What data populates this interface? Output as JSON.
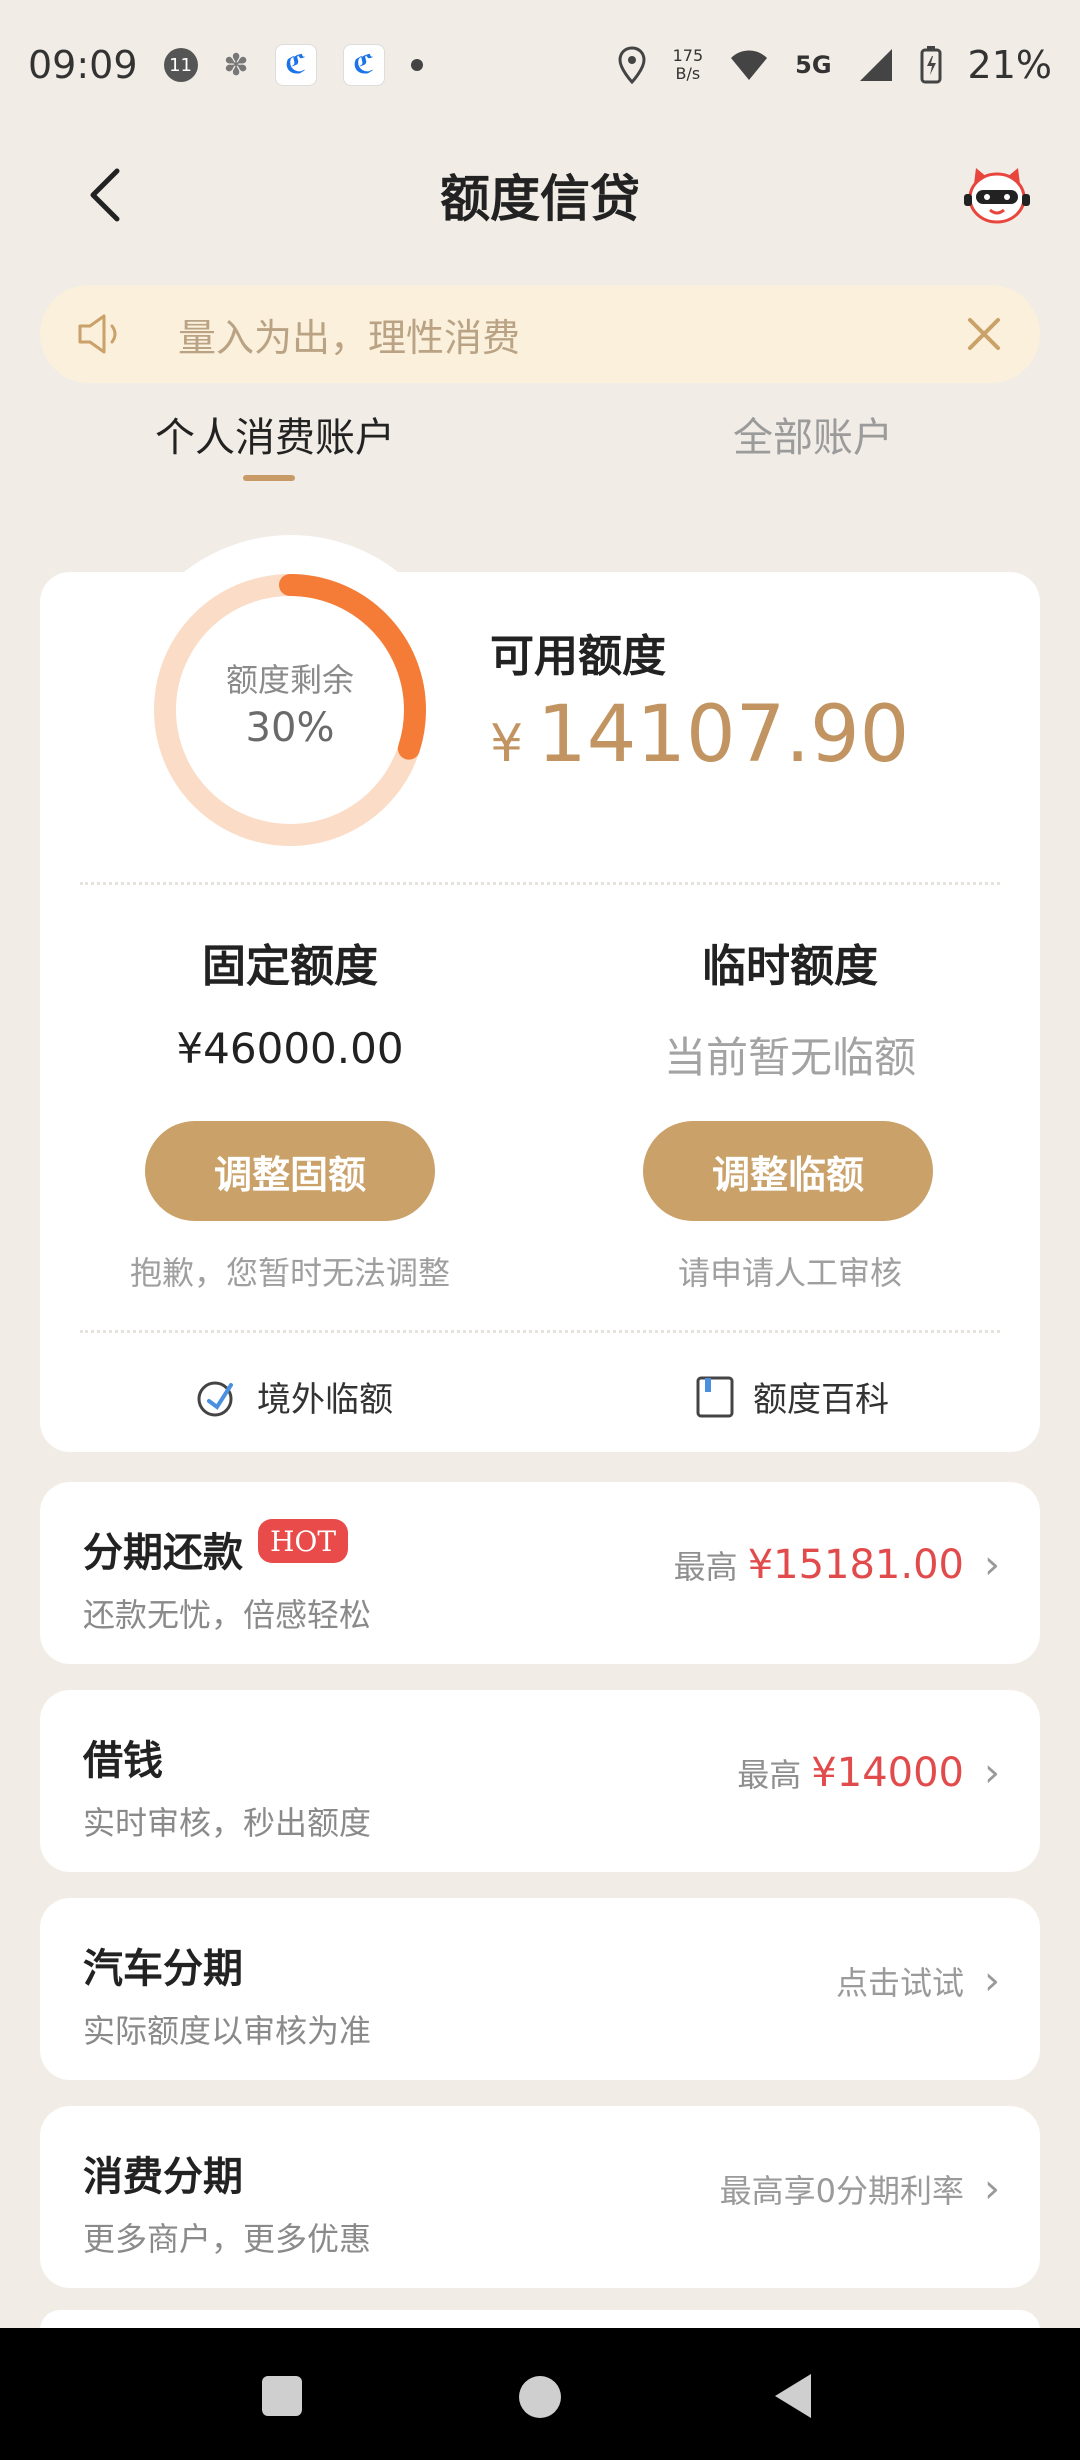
{
  "status_bar": {
    "time": "09:09",
    "notif_count": "11",
    "speed_value": "175",
    "speed_unit": "B/s",
    "network": "5G",
    "battery": "21%"
  },
  "header": {
    "title": "额度信贷"
  },
  "notice": {
    "text": "量入为出，理性消费"
  },
  "tabs": [
    {
      "label": "个人消费账户",
      "active": true
    },
    {
      "label": "全部账户",
      "active": false
    }
  ],
  "credit": {
    "ring_label": "额度剩余",
    "ring_percent": "30%",
    "ring_fraction": 0.3,
    "available_label": "可用额度",
    "currency": "¥",
    "available_amount": "14107.90",
    "fixed": {
      "title": "固定额度",
      "value": "¥46000.00",
      "button": "调整固额",
      "note": "抱歉，您暂时无法调整"
    },
    "temporary": {
      "title": "临时额度",
      "value": "当前暂无临额",
      "button": "调整临额",
      "note": "请申请人工审核"
    },
    "links": {
      "overseas": "境外临额",
      "encyclopedia": "额度百科"
    }
  },
  "services": [
    {
      "title": "分期还款",
      "badge": "HOT",
      "subtitle": "还款无忧，倍感轻松",
      "prefix": "最高",
      "amount": "¥15181.00"
    },
    {
      "title": "借钱",
      "subtitle": "实时审核，秒出额度",
      "prefix": "最高",
      "amount": "¥14000"
    },
    {
      "title": "汽车分期",
      "subtitle": "实际额度以审核为准",
      "action": "点击试试"
    },
    {
      "title": "消费分期",
      "subtitle": "更多商户，更多优惠",
      "action": "最高享0分期利率"
    }
  ],
  "colors": {
    "accent_gold": "#c9a169",
    "ring_orange": "#f47c36",
    "price_red": "#e24b4b",
    "background": "#f1ece6"
  }
}
